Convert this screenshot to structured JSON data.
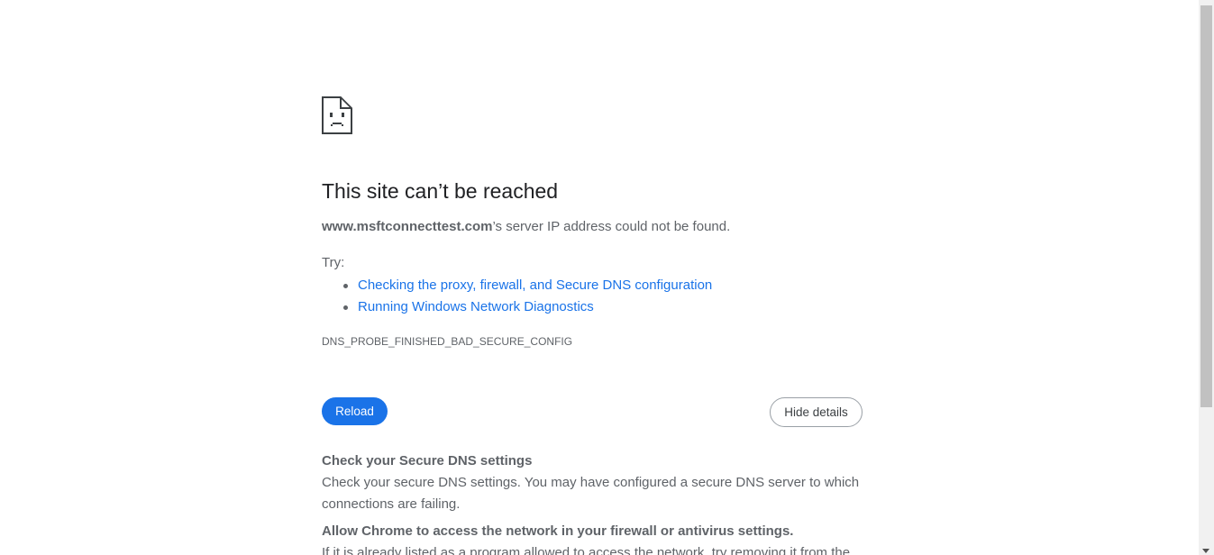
{
  "error": {
    "icon": "sad-page-icon",
    "title": "This site can’t be reached",
    "host": "www.msftconnecttest.com",
    "summary_suffix": "’s server IP address could not be found.",
    "try_label": "Try:",
    "suggestions": [
      "Checking the proxy, firewall, and Secure DNS configuration",
      "Running Windows Network Diagnostics"
    ],
    "code": "DNS_PROBE_FINISHED_BAD_SECURE_CONFIG"
  },
  "buttons": {
    "reload_label": "Reload",
    "details_label": "Hide details"
  },
  "details": {
    "sections": [
      {
        "heading": "Check your Secure DNS settings",
        "body": "Check your secure DNS settings. You may have configured a secure DNS server to which connections are failing."
      },
      {
        "heading": "Allow Chrome to access the network in your firewall or antivirus settings.",
        "body": "If it is already listed as a program allowed to access the network, try removing it from the"
      }
    ]
  },
  "colors": {
    "accent": "#1a73e8",
    "text_primary": "#202124",
    "text_secondary": "#5f6368"
  }
}
